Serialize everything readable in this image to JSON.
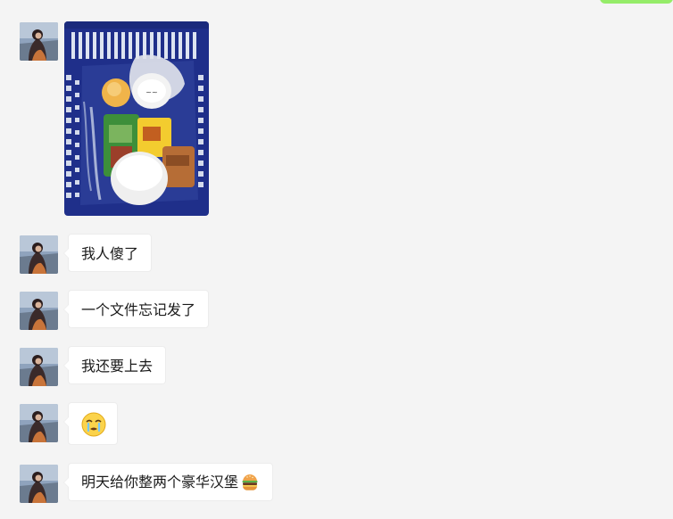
{
  "chat": {
    "messages": [
      {
        "type": "image",
        "image_icon": "shopping-basket-photo"
      },
      {
        "type": "text",
        "text": "我人傻了"
      },
      {
        "type": "text",
        "text": "一个文件忘记发了"
      },
      {
        "type": "text",
        "text": "我还要上去"
      },
      {
        "type": "emoji",
        "emoji_icon": "crying-face-emoji"
      },
      {
        "type": "text",
        "text": "明天给你整两个豪华汉堡",
        "trailing_icon": "hamburger-emoji"
      }
    ]
  },
  "colors": {
    "background": "#f4f4f4",
    "bubble": "#ffffff",
    "bubble_border": "#ececec",
    "self_bubble": "#95ec69",
    "text": "#1a1a1a"
  }
}
